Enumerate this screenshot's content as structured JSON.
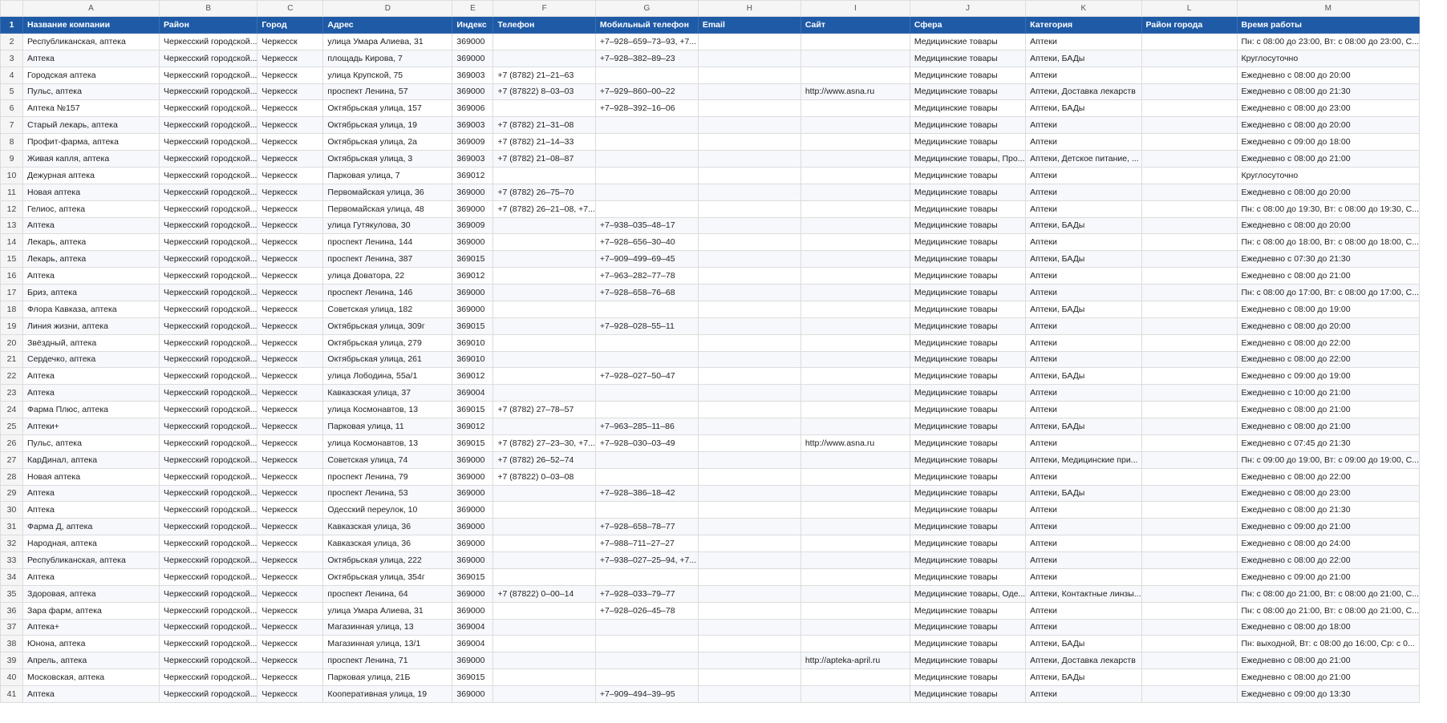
{
  "columns": [
    "A",
    "B",
    "C",
    "D",
    "E",
    "F",
    "G",
    "H",
    "I",
    "J",
    "K",
    "L",
    "M"
  ],
  "header": {
    "row": "1",
    "cells": [
      "Название компании",
      "Район",
      "Город",
      "Адрес",
      "Индекс",
      "Телефон",
      "Мобильный телефон",
      "Email",
      "Сайт",
      "Сфера",
      "Категория",
      "Район города",
      "Время работы"
    ]
  },
  "rows": [
    {
      "n": "2",
      "c": [
        "Республиканская, аптека",
        "Черкесский городской...",
        "Черкесск",
        "улица Умара Алиева, 31",
        "369000",
        "",
        "+7–928–659–73–93, +7...",
        "",
        "",
        "Медицинские товары",
        "Аптеки",
        "",
        "Пн: с 08:00 до 23:00, Вт: с 08:00 до 23:00, С..."
      ]
    },
    {
      "n": "3",
      "c": [
        "Аптека",
        "Черкесский городской...",
        "Черкесск",
        "площадь Кирова, 7",
        "369000",
        "",
        "+7–928–382–89–23",
        "",
        "",
        "Медицинские товары",
        "Аптеки, БАДы",
        "",
        "Круглосуточно"
      ]
    },
    {
      "n": "4",
      "c": [
        "Городская аптека",
        "Черкесский городской...",
        "Черкесск",
        "улица Крупской, 75",
        "369003",
        "+7 (8782) 21–21–63",
        "",
        "",
        "",
        "Медицинские товары",
        "Аптеки",
        "",
        "Ежедневно с 08:00 до 20:00"
      ]
    },
    {
      "n": "5",
      "c": [
        "Пульс, аптека",
        "Черкесский городской...",
        "Черкесск",
        "проспект Ленина, 57",
        "369000",
        "+7 (87822) 8–03–03",
        "+7–929–860–00–22",
        "",
        "http://www.asna.ru",
        "Медицинские товары",
        "Аптеки, Доставка лекарств",
        "",
        "Ежедневно с 08:00 до 21:30"
      ]
    },
    {
      "n": "6",
      "c": [
        "Аптека №157",
        "Черкесский городской...",
        "Черкесск",
        "Октябрьская улица, 157",
        "369006",
        "",
        "+7–928–392–16–06",
        "",
        "",
        "Медицинские товары",
        "Аптеки, БАДы",
        "",
        "Ежедневно с 08:00 до 23:00"
      ]
    },
    {
      "n": "7",
      "c": [
        "Старый лекарь, аптека",
        "Черкесский городской...",
        "Черкесск",
        "Октябрьская улица, 19",
        "369003",
        "+7 (8782) 21–31–08",
        "",
        "",
        "",
        "Медицинские товары",
        "Аптеки",
        "",
        "Ежедневно с 08:00 до 20:00"
      ]
    },
    {
      "n": "8",
      "c": [
        "Профит-фарма, аптека",
        "Черкесский городской...",
        "Черкесск",
        "Октябрьская улица, 2а",
        "369009",
        "+7 (8782) 21–14–33",
        "",
        "",
        "",
        "Медицинские товары",
        "Аптеки",
        "",
        "Ежедневно с 09:00 до 18:00"
      ]
    },
    {
      "n": "9",
      "c": [
        "Живая капля, аптека",
        "Черкесский городской...",
        "Черкесск",
        "Октябрьская улица, 3",
        "369003",
        "+7 (8782) 21–08–87",
        "",
        "",
        "",
        "Медицинские товары, Про...",
        "Аптеки, Детское питание, ...",
        "",
        "Ежедневно с 08:00 до 21:00"
      ]
    },
    {
      "n": "10",
      "c": [
        "Дежурная аптека",
        "Черкесский городской...",
        "Черкесск",
        "Парковая улица, 7",
        "369012",
        "",
        "",
        "",
        "",
        "Медицинские товары",
        "Аптеки",
        "",
        "Круглосуточно"
      ]
    },
    {
      "n": "11",
      "c": [
        "Новая аптека",
        "Черкесский городской...",
        "Черкесск",
        "Первомайская улица, 36",
        "369000",
        "+7 (8782) 26–75–70",
        "",
        "",
        "",
        "Медицинские товары",
        "Аптеки",
        "",
        "Ежедневно с 08:00 до 20:00"
      ]
    },
    {
      "n": "12",
      "c": [
        "Гелиос, аптека",
        "Черкесский городской...",
        "Черкесск",
        "Первомайская улица, 48",
        "369000",
        "+7 (8782) 26–21–08, +7...",
        "",
        "",
        "",
        "Медицинские товары",
        "Аптеки",
        "",
        "Пн: с 08:00 до 19:30, Вт: с 08:00 до 19:30, С..."
      ]
    },
    {
      "n": "13",
      "c": [
        "Аптека",
        "Черкесский городской...",
        "Черкесск",
        "улица Гутякулова, 30",
        "369009",
        "",
        "+7–938–035–48–17",
        "",
        "",
        "Медицинские товары",
        "Аптеки, БАДы",
        "",
        "Ежедневно с 08:00 до 20:00"
      ]
    },
    {
      "n": "14",
      "c": [
        "Лекарь, аптека",
        "Черкесский городской...",
        "Черкесск",
        "проспект Ленина, 144",
        "369000",
        "",
        "+7–928–656–30–40",
        "",
        "",
        "Медицинские товары",
        "Аптеки",
        "",
        "Пн: с 08:00 до 18:00, Вт: с 08:00 до 18:00, С..."
      ]
    },
    {
      "n": "15",
      "c": [
        "Лекарь, аптека",
        "Черкесский городской...",
        "Черкесск",
        "проспект Ленина, 387",
        "369015",
        "",
        "+7–909–499–69–45",
        "",
        "",
        "Медицинские товары",
        "Аптеки, БАДы",
        "",
        "Ежедневно с 07:30 до 21:30"
      ]
    },
    {
      "n": "16",
      "c": [
        "Аптека",
        "Черкесский городской...",
        "Черкесск",
        "улица Доватора, 22",
        "369012",
        "",
        "+7–963–282–77–78",
        "",
        "",
        "Медицинские товары",
        "Аптеки",
        "",
        "Ежедневно с 08:00 до 21:00"
      ]
    },
    {
      "n": "17",
      "c": [
        "Бриз, аптека",
        "Черкесский городской...",
        "Черкесск",
        "проспект Ленина, 146",
        "369000",
        "",
        "+7–928–658–76–68",
        "",
        "",
        "Медицинские товары",
        "Аптеки",
        "",
        "Пн: с 08:00 до 17:00, Вт: с 08:00 до 17:00, С..."
      ]
    },
    {
      "n": "18",
      "c": [
        "Флора Кавказа, аптека",
        "Черкесский городской...",
        "Черкесск",
        "Советская улица, 182",
        "369000",
        "",
        "",
        "",
        "",
        "Медицинские товары",
        "Аптеки, БАДы",
        "",
        "Ежедневно с 08:00 до 19:00"
      ]
    },
    {
      "n": "19",
      "c": [
        "Линия жизни, аптека",
        "Черкесский городской...",
        "Черкесск",
        "Октябрьская улица, 309г",
        "369015",
        "",
        "+7–928–028–55–11",
        "",
        "",
        "Медицинские товары",
        "Аптеки",
        "",
        "Ежедневно с 08:00 до 20:00"
      ]
    },
    {
      "n": "20",
      "c": [
        "Звёздный, аптека",
        "Черкесский городской...",
        "Черкесск",
        "Октябрьская улица, 279",
        "369010",
        "",
        "",
        "",
        "",
        "Медицинские товары",
        "Аптеки",
        "",
        "Ежедневно с 08:00 до 22:00"
      ]
    },
    {
      "n": "21",
      "c": [
        "Сердечко, аптека",
        "Черкесский городской...",
        "Черкесск",
        "Октябрьская улица, 261",
        "369010",
        "",
        "",
        "",
        "",
        "Медицинские товары",
        "Аптеки",
        "",
        "Ежедневно с 08:00 до 22:00"
      ]
    },
    {
      "n": "22",
      "c": [
        "Аптека",
        "Черкесский городской...",
        "Черкесск",
        "улица Лободина, 55а/1",
        "369012",
        "",
        "+7–928–027–50–47",
        "",
        "",
        "Медицинские товары",
        "Аптеки, БАДы",
        "",
        "Ежедневно с 09:00 до 19:00"
      ]
    },
    {
      "n": "23",
      "c": [
        "Аптека",
        "Черкесский городской...",
        "Черкесск",
        "Кавказская улица, 37",
        "369004",
        "",
        "",
        "",
        "",
        "Медицинские товары",
        "Аптеки",
        "",
        "Ежедневно с 10:00 до 21:00"
      ]
    },
    {
      "n": "24",
      "c": [
        "Фарма Плюс, аптека",
        "Черкесский городской...",
        "Черкесск",
        "улица Космонавтов, 13",
        "369015",
        "+7 (8782) 27–78–57",
        "",
        "",
        "",
        "Медицинские товары",
        "Аптеки",
        "",
        "Ежедневно с 08:00 до 21:00"
      ]
    },
    {
      "n": "25",
      "c": [
        "Аптеки+",
        "Черкесский городской...",
        "Черкесск",
        "Парковая улица, 11",
        "369012",
        "",
        "+7–963–285–11–86",
        "",
        "",
        "Медицинские товары",
        "Аптеки, БАДы",
        "",
        "Ежедневно с 08:00 до 21:00"
      ]
    },
    {
      "n": "26",
      "c": [
        "Пульс, аптека",
        "Черкесский городской...",
        "Черкесск",
        "улица Космонавтов, 13",
        "369015",
        "+7 (8782) 27–23–30, +7...",
        "+7–928–030–03–49",
        "",
        "http://www.asna.ru",
        "Медицинские товары",
        "Аптеки",
        "",
        "Ежедневно с 07:45 до 21:30"
      ]
    },
    {
      "n": "27",
      "c": [
        "КарДинал, аптека",
        "Черкесский городской...",
        "Черкесск",
        "Советская улица, 74",
        "369000",
        "+7 (8782) 26–52–74",
        "",
        "",
        "",
        "Медицинские товары",
        "Аптеки, Медицинские при...",
        "",
        "Пн: с 09:00 до 19:00, Вт: с 09:00 до 19:00, С..."
      ]
    },
    {
      "n": "28",
      "c": [
        "Новая аптека",
        "Черкесский городской...",
        "Черкесск",
        "проспект Ленина, 79",
        "369000",
        "+7 (87822) 0–03–08",
        "",
        "",
        "",
        "Медицинские товары",
        "Аптеки",
        "",
        "Ежедневно с 08:00 до 22:00"
      ]
    },
    {
      "n": "29",
      "c": [
        "Аптека",
        "Черкесский городской...",
        "Черкесск",
        "проспект Ленина, 53",
        "369000",
        "",
        "+7–928–386–18–42",
        "",
        "",
        "Медицинские товары",
        "Аптеки, БАДы",
        "",
        "Ежедневно с 08:00 до 23:00"
      ]
    },
    {
      "n": "30",
      "c": [
        "Аптека",
        "Черкесский городской...",
        "Черкесск",
        "Одесский переулок, 10",
        "369000",
        "",
        "",
        "",
        "",
        "Медицинские товары",
        "Аптеки",
        "",
        "Ежедневно с 08:00 до 21:30"
      ]
    },
    {
      "n": "31",
      "c": [
        "Фарма Д, аптека",
        "Черкесский городской...",
        "Черкесск",
        "Кавказская улица, 36",
        "369000",
        "",
        "+7–928–658–78–77",
        "",
        "",
        "Медицинские товары",
        "Аптеки",
        "",
        "Ежедневно с 09:00 до 21:00"
      ]
    },
    {
      "n": "32",
      "c": [
        "Народная, аптека",
        "Черкесский городской...",
        "Черкесск",
        "Кавказская улица, 36",
        "369000",
        "",
        "+7–988–711–27–27",
        "",
        "",
        "Медицинские товары",
        "Аптеки",
        "",
        "Ежедневно с 08:00 до 24:00"
      ]
    },
    {
      "n": "33",
      "c": [
        "Республиканская, аптека",
        "Черкесский городской...",
        "Черкесск",
        "Октябрьская улица, 222",
        "369000",
        "",
        "+7–938–027–25–94, +7...",
        "",
        "",
        "Медицинские товары",
        "Аптеки",
        "",
        "Ежедневно с 08:00 до 22:00"
      ]
    },
    {
      "n": "34",
      "c": [
        "Аптека",
        "Черкесский городской...",
        "Черкесск",
        "Октябрьская улица, 354г",
        "369015",
        "",
        "",
        "",
        "",
        "Медицинские товары",
        "Аптеки",
        "",
        "Ежедневно с 09:00 до 21:00"
      ]
    },
    {
      "n": "35",
      "c": [
        "Здоровая, аптека",
        "Черкесский городской...",
        "Черкесск",
        "проспект Ленина, 64",
        "369000",
        "+7 (87822) 0–00–14",
        "+7–928–033–79–77",
        "",
        "",
        "Медицинские товары, Оде...",
        "Аптеки, Контактные линзы...",
        "",
        "Пн: с 08:00 до 21:00, Вт: с 08:00 до 21:00, С..."
      ]
    },
    {
      "n": "36",
      "c": [
        "Зара фарм, аптека",
        "Черкесский городской...",
        "Черкесск",
        "улица Умара Алиева, 31",
        "369000",
        "",
        "+7–928–026–45–78",
        "",
        "",
        "Медицинские товары",
        "Аптеки",
        "",
        "Пн: с 08:00 до 21:00, Вт: с 08:00 до 21:00, С..."
      ]
    },
    {
      "n": "37",
      "c": [
        "Аптека+",
        "Черкесский городской...",
        "Черкесск",
        "Магазинная улица, 13",
        "369004",
        "",
        "",
        "",
        "",
        "Медицинские товары",
        "Аптеки",
        "",
        "Ежедневно с 08:00 до 18:00"
      ]
    },
    {
      "n": "38",
      "c": [
        "Юнона, аптека",
        "Черкесский городской...",
        "Черкесск",
        "Магазинная улица, 13/1",
        "369004",
        "",
        "",
        "",
        "",
        "Медицинские товары",
        "Аптеки, БАДы",
        "",
        "Пн: выходной, Вт: с 08:00 до 16:00, Ср: с 0..."
      ]
    },
    {
      "n": "39",
      "c": [
        "Апрель, аптека",
        "Черкесский городской...",
        "Черкесск",
        "проспект Ленина, 71",
        "369000",
        "",
        "",
        "",
        "http://apteka-april.ru",
        "Медицинские товары",
        "Аптеки, Доставка лекарств",
        "",
        "Ежедневно с 08:00 до 21:00"
      ]
    },
    {
      "n": "40",
      "c": [
        "Московская, аптека",
        "Черкесский городской...",
        "Черкесск",
        "Парковая улица, 21Б",
        "369015",
        "",
        "",
        "",
        "",
        "Медицинские товары",
        "Аптеки, БАДы",
        "",
        "Ежедневно с 08:00 до 21:00"
      ]
    },
    {
      "n": "41",
      "c": [
        "Аптека",
        "Черкесский городской...",
        "Черкесск",
        "Кооперативная улица, 19",
        "369000",
        "",
        "+7–909–494–39–95",
        "",
        "",
        "Медицинские товары",
        "Аптеки",
        "",
        "Ежедневно с 09:00 до 13:30"
      ]
    }
  ]
}
